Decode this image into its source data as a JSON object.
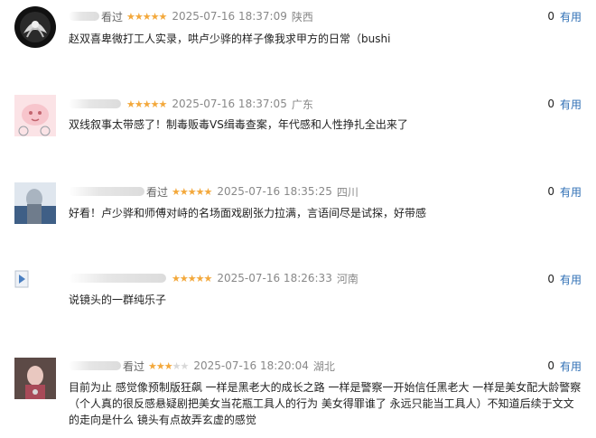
{
  "reviews": [
    {
      "viewed": "看过",
      "stars": 5,
      "time": "2025-07-16 18:37:09",
      "location": "陕西",
      "useful_count": "0",
      "useful_label": "有用",
      "text": "赵双喜卑微打工人实录，哄卢少骅的样子像我求甲方的日常（bushi"
    },
    {
      "viewed": "",
      "stars": 5,
      "time": "2025-07-16 18:37:05",
      "location": "广东",
      "useful_count": "0",
      "useful_label": "有用",
      "text": "双线叙事太带感了！制毒贩毒VS缉毒查案，年代感和人性挣扎全出来了"
    },
    {
      "viewed": "看过",
      "stars": 5,
      "time": "2025-07-16 18:35:25",
      "location": "四川",
      "useful_count": "0",
      "useful_label": "有用",
      "text": "好看！卢少骅和师傅对峙的名场面戏剧张力拉满，言语间尽是试探，好带感"
    },
    {
      "viewed": "",
      "stars": 5,
      "time": "2025-07-16 18:26:33",
      "location": "河南",
      "useful_count": "0",
      "useful_label": "有用",
      "text": "说镜头的一群纯乐子"
    },
    {
      "viewed": "看过",
      "stars": 3,
      "time": "2025-07-16 18:20:04",
      "location": "湖北",
      "useful_count": "0",
      "useful_label": "有用",
      "text": "目前为止 感觉像预制版狂飙 一样是黑老大的成长之路 一样是警察一开始信任黑老大 一样是美女配大龄警察（个人真的很反感悬疑剧把美女当花瓶工具人的行为 美女得罪谁了 永远只能当工具人）不知道后续于文文的走向是什么 镜头有点故弄玄虚的感觉"
    }
  ],
  "colors": {
    "star": "#f3a83b",
    "star_off": "#d8d8d8",
    "useful_link": "#2f6fb5",
    "meta": "#999999"
  }
}
